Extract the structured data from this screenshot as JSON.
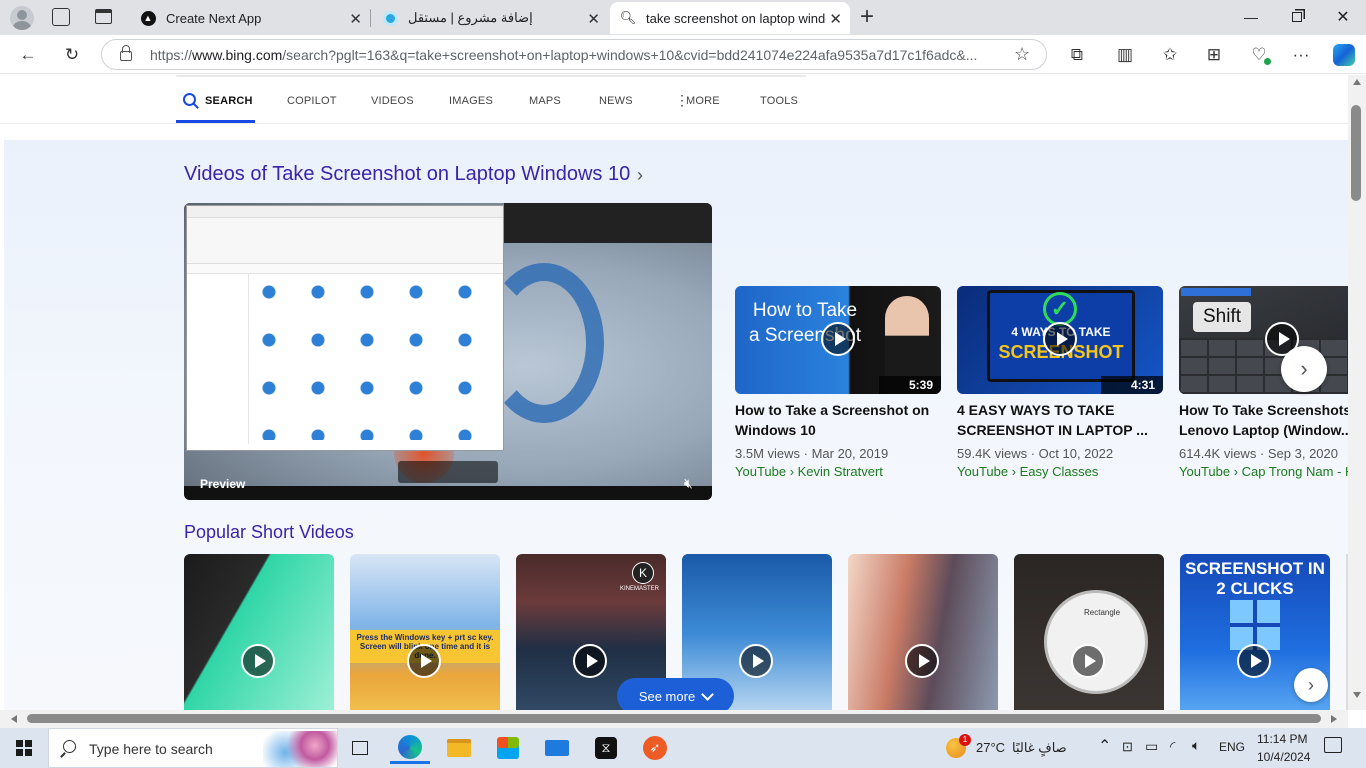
{
  "browser": {
    "tabs": [
      {
        "title": "Create Next App",
        "active": false
      },
      {
        "title": "إضافة مشروع | مستقل",
        "active": false
      },
      {
        "title": "take screenshot on laptop window",
        "active": true
      }
    ],
    "new_tab": "+",
    "url_prefix": "https://",
    "url_domain": "www.bing.com",
    "url_rest": "/search?pglt=163&q=take+screenshot+on+laptop+windows+10&cvid=bdd241074e224afa9535a7d17c1f6adc&..."
  },
  "bing_nav": {
    "items": [
      "SEARCH",
      "COPILOT",
      "VIDEOS",
      "IMAGES",
      "MAPS",
      "NEWS",
      "MORE",
      "TOOLS"
    ],
    "active": "SEARCH"
  },
  "videos": {
    "title": "Videos of Take Screenshot on Laptop Windows 10",
    "preview_label": "Preview",
    "cards": [
      {
        "title_line1": "How to Take a Screenshot on",
        "title_line2": "Windows 10",
        "duration": "5:39",
        "meta": "3.5M views · Mar 20, 2019",
        "source": "YouTube › Kevin Stratvert",
        "thumb_text": "How to Take a Screenshot"
      },
      {
        "title_line1": "4 EASY WAYS TO TAKE",
        "title_line2": "SCREENSHOT IN LAPTOP ...",
        "duration": "4:31",
        "meta": "59.4K views · Oct 10, 2022",
        "source": "YouTube › Easy Classes",
        "thumb_text_top": "4 WAYS TO TAKE",
        "thumb_text_bottom": "SCREENSHOT"
      },
      {
        "title_line1": "How To Take Screenshots on",
        "title_line2": "Lenovo Laptop (Window...",
        "duration": "",
        "meta": "614.4K views · Sep 3, 2020",
        "source": "YouTube › Cap Trong Nam - H",
        "thumb_text": "Shift"
      }
    ]
  },
  "shorts": {
    "title": "Popular Short Videos",
    "items": [
      {
        "overlay": ""
      },
      {
        "overlay": "Press the Windows key + prt sc key. Screen will blink one time and it is done."
      },
      {
        "overlay": "KINEMASTER"
      },
      {
        "overlay": ""
      },
      {
        "overlay": ""
      },
      {
        "overlay": "Rectangle"
      },
      {
        "overlay": "SCREENSHOT IN 2 CLICKS"
      }
    ],
    "see_more": "See more"
  },
  "taskbar": {
    "search_placeholder": "Type here to search",
    "weather_temp": "27°C",
    "weather_text": "صافٍ غالبًا",
    "lang": "ENG",
    "time": "11:14 PM",
    "date": "10/4/2024",
    "weather_badge": "1"
  },
  "colors": {
    "accent": "#174ae4",
    "link_purple": "#3a24a8",
    "source_green": "#1a7b1e",
    "see_more_blue": "#1d5fd6"
  }
}
